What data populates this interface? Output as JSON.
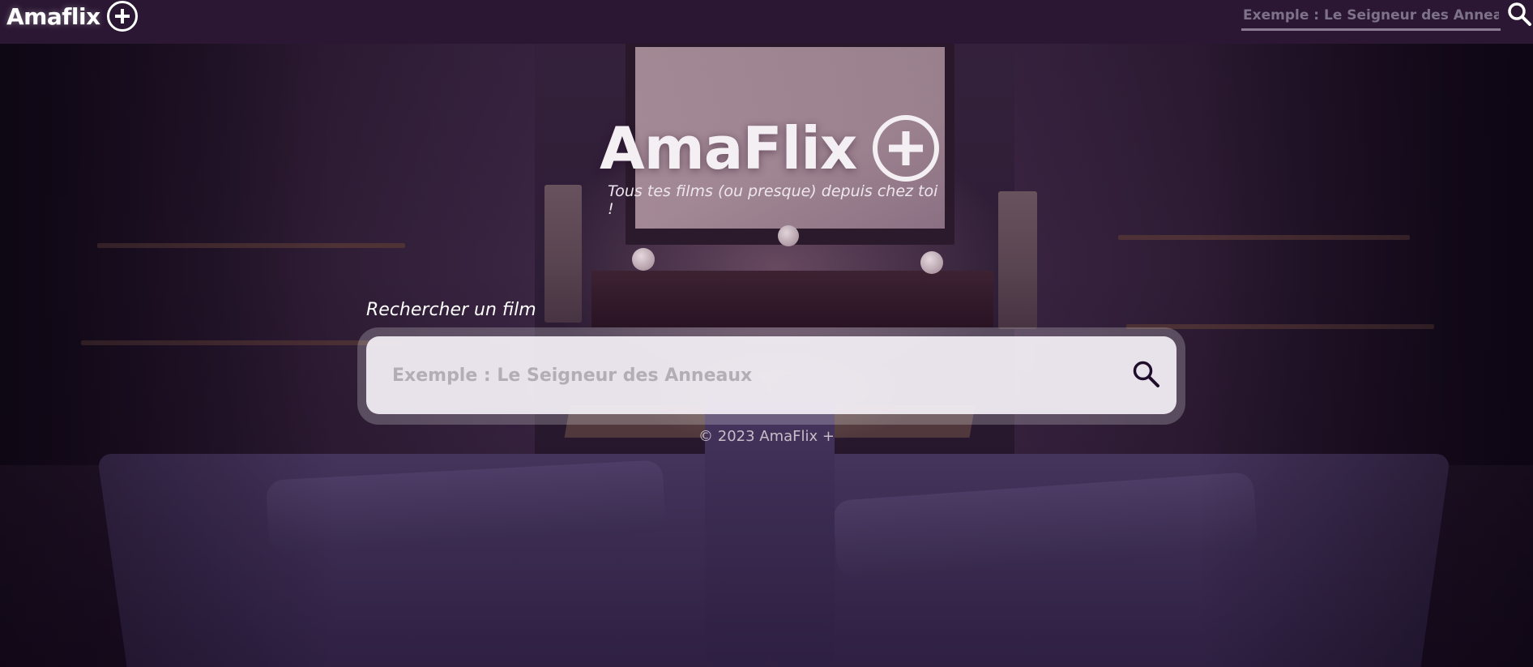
{
  "nav": {
    "brand": "Amaflix",
    "brand_icon": "plus-circle-icon",
    "search_placeholder": "Exemple : Le Seigneur des Anneaux",
    "search_icon": "search-icon"
  },
  "hero": {
    "title": "AmaFlix",
    "title_icon": "plus-circle-icon",
    "tagline": "Tous tes films (ou presque) depuis chez toi !"
  },
  "search": {
    "label": "Rechercher un film",
    "placeholder": "Exemple : Le Seigneur des Anneaux",
    "button_icon": "search-icon"
  },
  "footer": {
    "text": "© 2023 AmaFlix +"
  },
  "colors": {
    "nav_background": "#2b1733",
    "accent_text": "#ffffff",
    "search_icon": "#1f0d2b"
  }
}
